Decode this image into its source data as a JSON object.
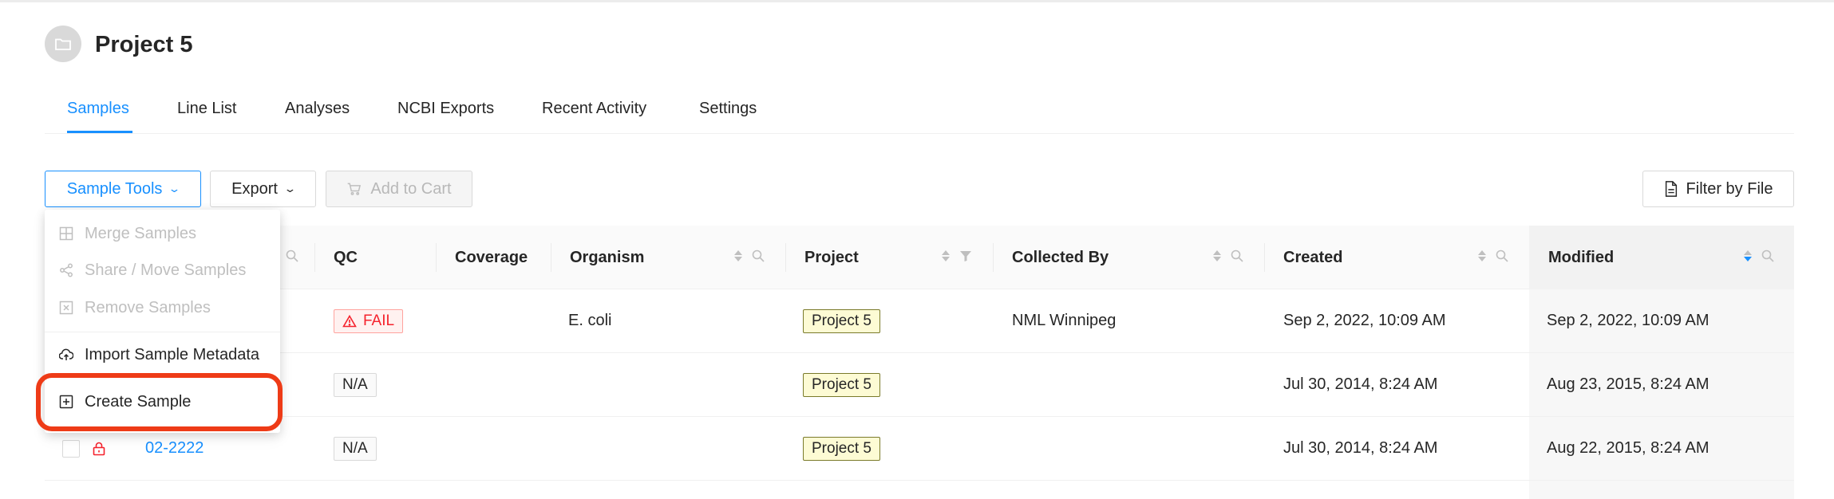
{
  "project": {
    "title": "Project 5",
    "avatar_icon": "folder-icon"
  },
  "tabs": [
    {
      "label": "Samples",
      "active": true
    },
    {
      "label": "Line List",
      "active": false
    },
    {
      "label": "Analyses",
      "active": false
    },
    {
      "label": "NCBI Exports",
      "active": false
    },
    {
      "label": "Recent Activity",
      "active": false
    },
    {
      "label": "Settings",
      "active": false
    }
  ],
  "toolbar": {
    "sample_tools_label": "Sample Tools",
    "export_label": "Export",
    "add_to_cart_label": "Add to Cart",
    "filter_by_file_label": "Filter by File"
  },
  "sample_tools_menu": [
    {
      "label": "Merge Samples",
      "icon": "merge-icon",
      "disabled": true
    },
    {
      "label": "Share / Move Samples",
      "icon": "share-icon",
      "disabled": true
    },
    {
      "label": "Remove Samples",
      "icon": "remove-icon",
      "disabled": true
    },
    {
      "label": "Import Sample Metadata",
      "icon": "cloud-upload-icon",
      "disabled": false
    },
    {
      "label": "Create Sample",
      "icon": "plus-square-icon",
      "disabled": false
    }
  ],
  "table": {
    "columns": [
      "QC",
      "Coverage",
      "Organism",
      "Project",
      "Collected By",
      "Created",
      "Modified"
    ],
    "rows": [
      {
        "sample": "",
        "qc": "FAIL",
        "coverage": "",
        "organism": "E. coli",
        "project": "Project 5",
        "collected_by": "NML Winnipeg",
        "created": "Sep 2, 2022, 10:09 AM",
        "modified": "Sep 2, 2022, 10:09 AM"
      },
      {
        "sample": "",
        "qc": "N/A",
        "coverage": "",
        "organism": "",
        "project": "Project 5",
        "collected_by": "",
        "created": "Jul 30, 2014, 8:24 AM",
        "modified": "Aug 23, 2015, 8:24 AM"
      },
      {
        "sample": "02-2222",
        "qc": "N/A",
        "coverage": "",
        "organism": "",
        "project": "Project 5",
        "collected_by": "",
        "created": "Jul 30, 2014, 8:24 AM",
        "modified": "Aug 22, 2015, 8:24 AM"
      }
    ]
  },
  "colors": {
    "accent": "#1890ff",
    "highlight": "#ee3b17",
    "fail": "#f5222d"
  }
}
